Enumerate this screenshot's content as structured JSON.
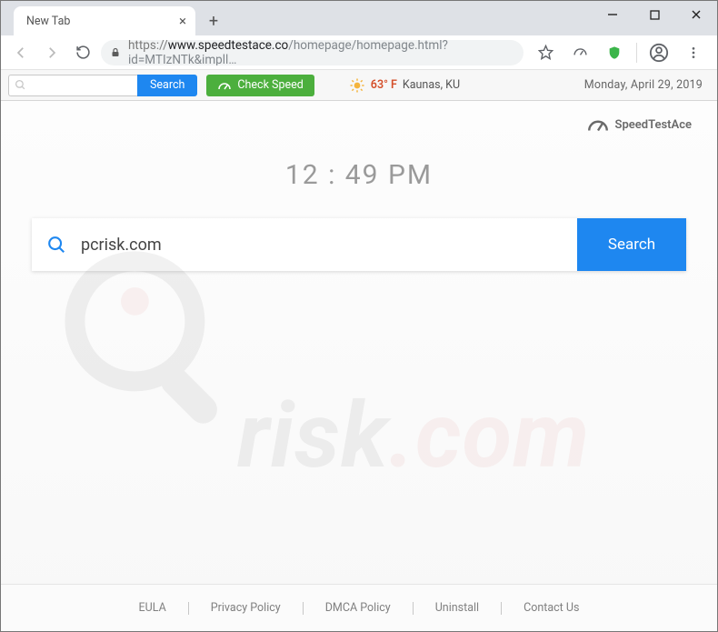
{
  "window": {
    "tab_title": "New Tab"
  },
  "address_bar": {
    "protocol": "https://",
    "host": "www.speedtestace.co",
    "path": "/homepage/homepage.html?id=MTIzNTk&impll…"
  },
  "ext_toolbar": {
    "search_button": "Search",
    "check_speed": "Check Speed",
    "weather": {
      "temp": "63° F",
      "location": "Kaunas, KU"
    },
    "date": "Monday, April 29, 2019"
  },
  "page": {
    "brand": "SpeedTestAce",
    "clock": "12 : 49 PM",
    "search_value": "pcrisk.com",
    "search_button": "Search"
  },
  "footer": {
    "links": [
      "EULA",
      "Privacy Policy",
      "DMCA Policy",
      "Uninstall",
      "Contact Us"
    ]
  },
  "watermark": {
    "text_a": "risk",
    "text_b": ".com"
  }
}
